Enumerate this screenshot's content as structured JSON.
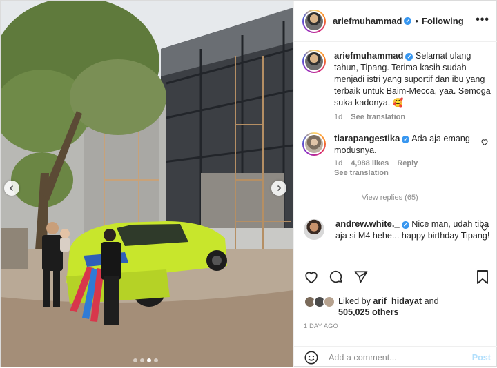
{
  "header": {
    "username": "ariefmuhammad",
    "separator": "•",
    "follow_status": "Following",
    "more_label": "•••"
  },
  "caption": {
    "username": "ariefmuhammad",
    "text": "Selamat ulang tahun, Tipang. Terima kasih sudah menjadi istri yang suportif dan ibu yang terbaik untuk Baim-Mecca, yaa. Semoga suka kadonya. 🥰",
    "time": "1d",
    "see_translation": "See translation"
  },
  "comments": [
    {
      "username": "tiarapangestika",
      "text": "Ada aja emang modusnya.",
      "time": "1d",
      "likes": "4,988 likes",
      "reply": "Reply",
      "see_translation": "See translation"
    },
    {
      "username": "andrew.white._",
      "text": "Nice man, udah tiba aja si M4 hehe... happy birthday Tipang!"
    }
  ],
  "view_replies": "View replies (65)",
  "likes": {
    "prefix": "Liked by ",
    "first_liker": "arif_hidayat",
    "middle": " and",
    "others": "505,025 others"
  },
  "time_ago": "1 DAY AGO",
  "comment_box": {
    "placeholder": "Add a comment...",
    "post_label": "Post"
  },
  "carousel": {
    "total_slides": 4,
    "active_slide": 3
  },
  "colors": {
    "verified": "#3897f0",
    "post_button": "#b2dffc",
    "meta_text": "#8e8e8e",
    "car": "#c8e62c"
  }
}
